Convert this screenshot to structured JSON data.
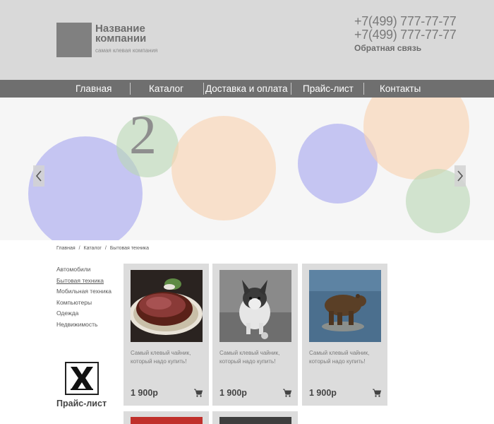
{
  "header": {
    "company_name": "Название компании",
    "company_tagline": "самая клевая компания",
    "phones": [
      "+7(499) 777-77-77",
      "+7(499) 777-77-77"
    ],
    "feedback": "Обратная связь"
  },
  "nav": {
    "items": [
      {
        "label": "Главная"
      },
      {
        "label": "Каталог"
      },
      {
        "label": "Доставка и оплата"
      },
      {
        "label": "Прайс-лист"
      },
      {
        "label": "Контакты"
      }
    ]
  },
  "slider": {
    "slide_number": "2",
    "prev_icon": "chevron-left-icon",
    "next_icon": "chevron-right-icon"
  },
  "breadcrumb": {
    "items": [
      "Главная",
      "Каталог",
      "Бытовая техника"
    ],
    "separator": "/"
  },
  "sidebar": {
    "items": [
      {
        "label": "Автомобили"
      },
      {
        "label": "Бытовая техника",
        "active": true
      },
      {
        "label": "Мобильная техника"
      },
      {
        "label": "Компьютеры"
      },
      {
        "label": "Одежда"
      },
      {
        "label": "Недвижимость"
      }
    ]
  },
  "pricelist": {
    "label": "Прайс-лист",
    "icon": "excel-icon"
  },
  "products": [
    {
      "image": "steak-photo",
      "description": "Самый клевый чайник, который надо купить!",
      "price": "1 900р"
    },
    {
      "image": "corgi-photo",
      "description": "Самый клевый чайник, который надо купить!",
      "price": "1 900р"
    },
    {
      "image": "bear-photo",
      "description": "Самый клевый чайник, который надо купить!",
      "price": "1 900р"
    }
  ],
  "colors": {
    "header_bg": "#d9d9d9",
    "nav_bg": "#6f6f6f",
    "card_bg": "#dcdcdc"
  }
}
